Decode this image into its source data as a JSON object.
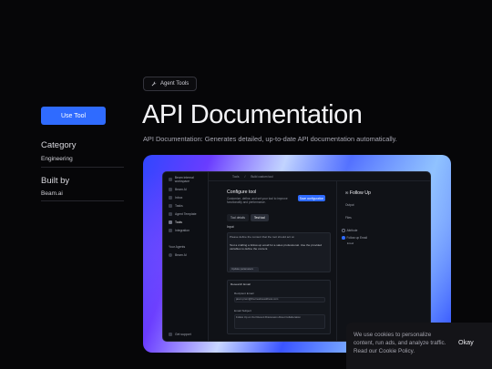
{
  "sidebar": {
    "use_tool_label": "Use Tool",
    "category_heading": "Category",
    "category_value": "Engineering",
    "built_by_heading": "Built by",
    "built_by_value": "Beam.ai"
  },
  "header": {
    "tag_label": "Agent Tools",
    "title": "API Documentation",
    "subtitle": "API Documentation: Generates detailed, up-to-date API documentation automatically."
  },
  "hero_app": {
    "top_path": [
      "Tools",
      "Build custom tool"
    ],
    "nav_items": [
      "Beam AI",
      "Inbox",
      "Tasks",
      "Agent Template",
      "Tools",
      "Integration"
    ],
    "your_agents_label": "Your Agents",
    "agent_item": "Beam AI",
    "support_label": "Get support",
    "panel_title": "Configure tool",
    "panel_sub": "Customize, define, and set your tool to improve functionality and performance.",
    "save_label": "Save configuration",
    "seg_options": [
      "Tool details",
      "Test tool"
    ],
    "input_label": "Input",
    "prompt_hint": "Please define the content that the tool should act on",
    "prompt_text": "Test a crafting a follow-up email for a sales professional. Use the provided variables to define the content.",
    "variables_btn": "Update parameters",
    "response_label": "Research Email",
    "recipient_label": "Recipient Email",
    "recipient_value": "jason.prem@thecreativeaddress.com",
    "subject_label": "Email Subject",
    "subject_value": "Follow Up on Our Recent Discussion About Collaboration",
    "right_title": "Follow Up",
    "right_label": "Output",
    "files_label": "Files",
    "radio_a": "Attribute",
    "radio_b": "Follow up Email",
    "radio_b_sub": "Email"
  },
  "cookie": {
    "text": "We use cookies to personalize content, run ads, and analyze traffic. Read our Cookie Policy.",
    "okay_label": "Okay"
  },
  "colors": {
    "accent": "#2f6bff",
    "background": "#060608"
  }
}
